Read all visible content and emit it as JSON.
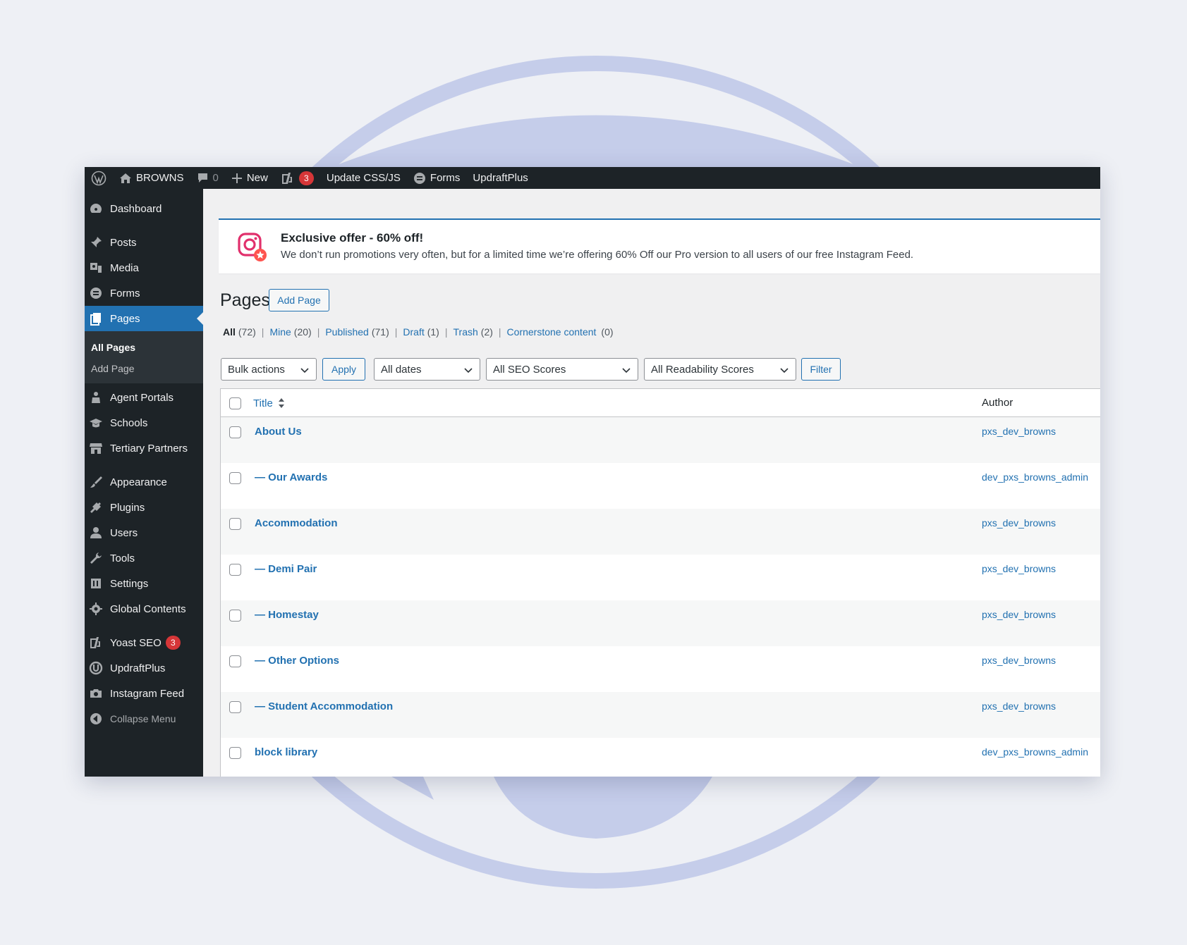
{
  "colors": {
    "accent": "#2271b1",
    "adminbar": "#1d2327",
    "badge": "#d63638",
    "background": "#eef0f5"
  },
  "adminbar": {
    "items": [
      {
        "icon": "wordpress-logo-icon",
        "label": ""
      },
      {
        "icon": "home-icon",
        "label": "BROWNS"
      },
      {
        "icon": "comment-icon",
        "label": "0"
      },
      {
        "icon": "plus-icon",
        "label": "New"
      },
      {
        "icon": "yoast-icon",
        "label": "3"
      },
      {
        "icon": "",
        "label": "Update CSS/JS"
      },
      {
        "icon": "forms-icon",
        "label": "Forms"
      },
      {
        "icon": "",
        "label": "UpdraftPlus"
      }
    ]
  },
  "sidebar": {
    "items": [
      {
        "label": "Dashboard",
        "icon": "dashboard-icon"
      },
      {
        "label": "Posts",
        "icon": "pin-icon"
      },
      {
        "label": "Media",
        "icon": "media-icon"
      },
      {
        "label": "Forms",
        "icon": "forms-icon"
      },
      {
        "label": "Pages",
        "icon": "pages-icon",
        "current": true
      },
      {
        "label": "Agent Portals",
        "icon": "person-icon"
      },
      {
        "label": "Schools",
        "icon": "graduation-cap-icon"
      },
      {
        "label": "Tertiary Partners",
        "icon": "store-icon"
      },
      {
        "label": "Appearance",
        "icon": "brush-icon"
      },
      {
        "label": "Plugins",
        "icon": "plug-icon"
      },
      {
        "label": "Users",
        "icon": "user-icon"
      },
      {
        "label": "Tools",
        "icon": "wrench-icon"
      },
      {
        "label": "Settings",
        "icon": "settings-icon"
      },
      {
        "label": "Global Contents",
        "icon": "gear-icon"
      },
      {
        "label": "Yoast SEO",
        "icon": "yoast-icon",
        "badge": "3"
      },
      {
        "label": "UpdraftPlus",
        "icon": "updraft-icon"
      },
      {
        "label": "Instagram Feed",
        "icon": "camera-icon"
      },
      {
        "label": "Collapse Menu",
        "icon": "collapse-icon"
      }
    ],
    "submenu": [
      "All Pages",
      "Add Page"
    ]
  },
  "notice": {
    "title": "Exclusive offer - 60% off!",
    "text": "We don’t run promotions very often, but for a limited time we’re offering 60% Off our Pro version to all users of our free Instagram Feed."
  },
  "page": {
    "title": "Pages",
    "add_button": "Add Page"
  },
  "filters": {
    "views": [
      {
        "label": "All",
        "count": "(72)"
      },
      {
        "label": "Mine",
        "count": "(20)"
      },
      {
        "label": "Published",
        "count": "(71)"
      },
      {
        "label": "Draft",
        "count": "(1)"
      },
      {
        "label": "Trash",
        "count": "(2)"
      },
      {
        "label": "Cornerstone content",
        "count": "(0)"
      }
    ],
    "bulk_actions": "Bulk actions",
    "apply": "Apply",
    "dates": "All dates",
    "seo": "All SEO Scores",
    "readability": "All Readability Scores",
    "filter": "Filter"
  },
  "table": {
    "col_title": "Title",
    "col_author": "Author",
    "rows": [
      {
        "title": "About Us",
        "author": "pxs_dev_browns"
      },
      {
        "title": "— Our Awards",
        "author": "dev_pxs_browns_admin"
      },
      {
        "title": "Accommodation",
        "author": "pxs_dev_browns"
      },
      {
        "title": "— Demi Pair",
        "author": "pxs_dev_browns"
      },
      {
        "title": "— Homestay",
        "author": "pxs_dev_browns"
      },
      {
        "title": "— Other Options",
        "author": "pxs_dev_browns"
      },
      {
        "title": "— Student Accommodation",
        "author": "pxs_dev_browns"
      },
      {
        "title": "block library",
        "author": "dev_pxs_browns_admin"
      }
    ]
  }
}
